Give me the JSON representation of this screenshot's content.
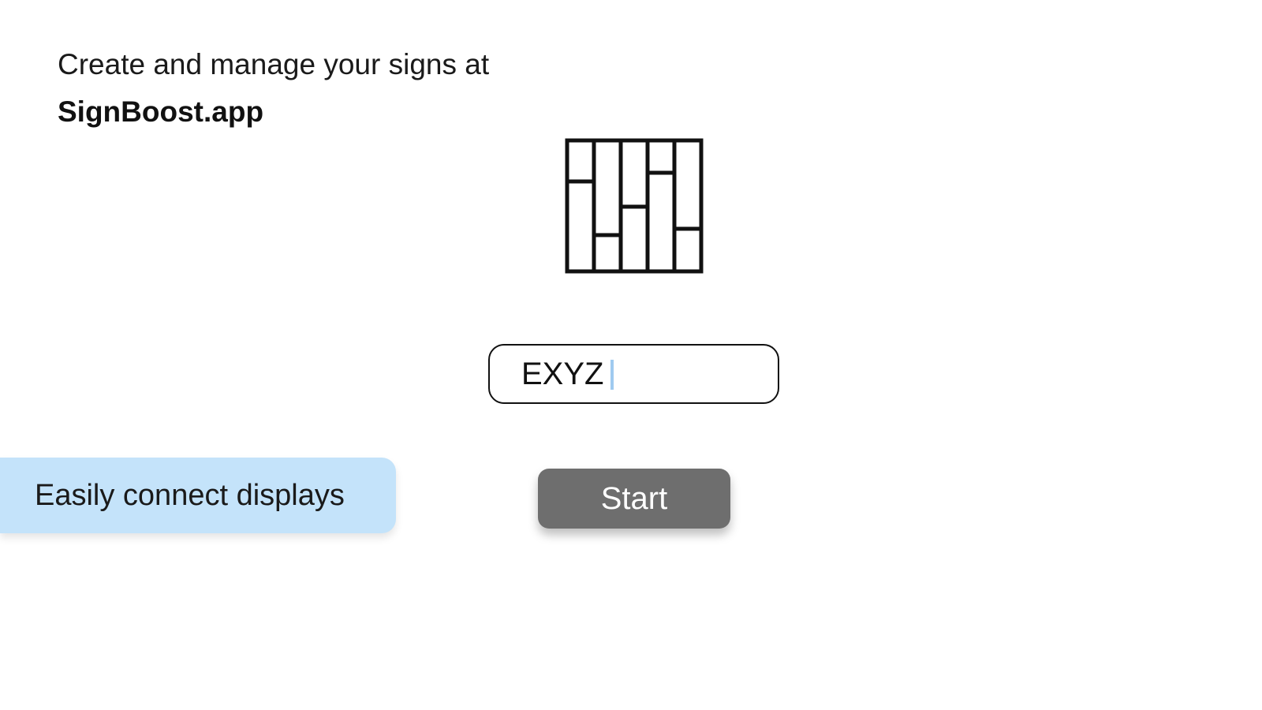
{
  "intro": {
    "line": "Create and manage your signs at",
    "link": "SignBoost.app"
  },
  "logo": {
    "icon": "signboost-logo-icon"
  },
  "code_input": {
    "value": "EXYZ"
  },
  "banner": {
    "text": "Easily connect displays"
  },
  "start_button": {
    "label": "Start"
  },
  "colors": {
    "banner_bg": "#c4e3fa",
    "button_bg": "#6e6e6e",
    "caret": "#9fcaf0"
  }
}
